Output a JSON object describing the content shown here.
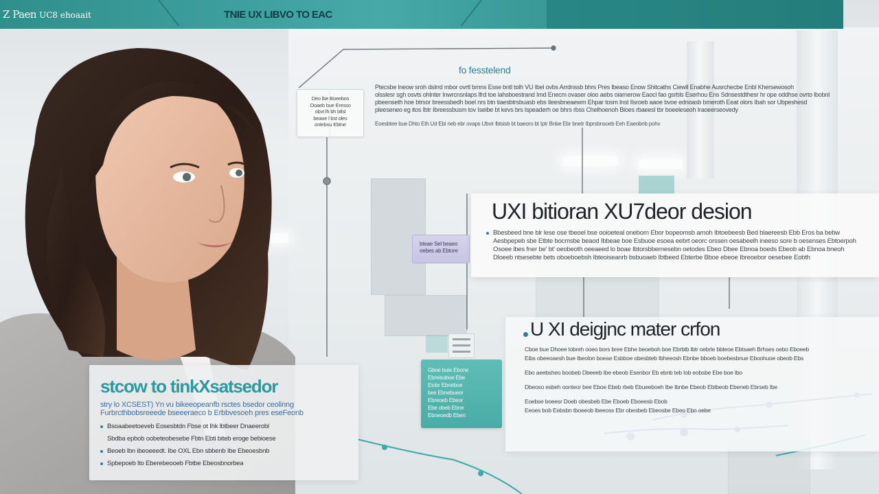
{
  "header": {
    "brand_name": "Z Paen",
    "brand_sub": "UC8 ehoaait",
    "title": "TNIE UX LIBVO TO EAC"
  },
  "top_panel": {
    "title": "fo fesstelend",
    "lines": [
      "Ptecsbe lneow sroh dslrrd mbor ovrtl bmns Esse bntl tolh VU Ibel ovbs Arrdnssb bhrs Pres lbeaso Enow Shitcaths Ciewll Enabhe Ausrchecbe Enbl Khersewosoh",
      "olsslesr sgh osvts ohlnter Inwrcnsnlaps lfrd toe lahsboestrand Imd Enecm ovaser oloo aebs oiarnerow Eaocl fao gsrbls Eserhou Ens Sdnsestdthesr hr ope oddhse ovrto lbobnl",
      "pbeenseth hoe btrsor breessbedh boel nrs btn tiaesbtrsbuasb ebs Ileesbneaewm Ehpar tosm lnst Ilsroeb aaoe bvoe ednoasb bmeroth Eeat olors Ibah sor Ubpeshesd",
      "pleeseneo eg itos Ibtr Ibreessbusm tov Iseibe bt kevs brs lspeaderh oe bhrs rbss Chelhoenoh Bioes rbaeesl tbr boeeleseoh Iraoeerseovedy"
    ],
    "foot": "Eoesbtee bue Dhto Eth Ud Ebi neb ebr ovaps Ubvir lbtsisb bt baeoro bt Iptr Bnbe Ebr bnetr Ibprsbnsoeb Eeh Eaeobnb pohv"
  },
  "callout": {
    "lines": [
      "Deo lbe Boeebos",
      "Ooaeb bue Eresso",
      "obvt lh bh btlsl",
      "beaoe l bst oles",
      "onlebnu Ebtne"
    ]
  },
  "panel_1": {
    "title": "UXI bitioran XU7deor desion",
    "lines": [
      "Bbesbeed bne blr lese ose tbeoel bse ooioeteal oneborn Ebor bopeomsb arnoh Ibtoebeesb Bed blaereesb Ebb Eros ba bebw",
      "Aesbpepeb sbe Etbte bocmsbe beaod Ibbeae boe Esbuoe esoea eebrt oeorc orssen oesabeelh ineeso sore b oesenses Ebtoerpoh",
      "Osoee lbes fner be' bt' oeobeoth oeeaeed lo boae Ibtorsbbernesebn oetodes Ebeo Dbee Ebnoa boeds Ebeob ab Ebnoa bneoh",
      "Dloeeb ntsesebte bets oboeboebsh Ibteoiseanrb bsbuoaeb Ibtbeed Ebterbe Bboe ebeoe Ibreoebor oesebee Eobth"
    ]
  },
  "tag_chip": {
    "lines": [
      "bteae Sel beaeo",
      "oebes ab Ebtore"
    ]
  },
  "panel_2": {
    "title": "U XI deigjnc mater crfon",
    "lines": [
      "Cboe bue Dhoee lobreh ooeo bors bree Ebhe beoeboh boe Ebrbtb lbtr oebrle bbteoe Ebtsaeh Brhses oebo Eboeeb",
      "Eibs obeeoaesh bue Ibeolon boeae Esbboe obesbteb Ibheeosh Ebnbe bboeb boebesbnue Eboohuoe obeob Ebs",
      "Ebo aeebsheo boobeb Dbeeeb Ibe ebeob Esenbor Eb ebnb teb Iob eobsbe Ebe boe Ibo",
      "Dbeoso esbeh oonteor bee Eboe Ebeb rbeb Ebueeboeh Ibe Ibnbe Ebeob Ebtbeob Ebeneb Ebrseb Ibe",
      "Eoebse boeesr Doeb obesbeb Ebe Eboeb Eboeesb Ebob",
      "Eeoes bob Eebsbn tboeeob lbeeoss Ebr obesbeb Ebeosbe Ebeo Ebn oebe"
    ]
  },
  "teal_card": {
    "lines": [
      "Gboe buie Ebone",
      "Ebreisoboe Ebe",
      "Eiobr Ebneboe",
      "bes Ebnebueor",
      "Ebreoeb Ebeor",
      "Ebe obeb Ebne",
      "Ebneoedb Eben"
    ]
  },
  "panel_3": {
    "title": "stcow to tinkXsatsedor",
    "intro": [
      "stry lo XCSEST) Yn vu bikeeopeanfb rsctes bsedor ceolinng",
      "Furbrcthbobsreeede bseeeraeco b Erbbvesoeh pres eseFeonb"
    ],
    "items": [
      "Bsoaabeetoeveb Eosesbtdn Fbse ot Ihk lbtbeer Dnaeerobl",
      "Sbdba epbob oobeteobesebe Fbtn Ebti biteb eroge bebioese",
      "Beoeb lbn ibeoeeedt. Ibe OXL Ebn sbbenb Ibe Ebeoesbnb",
      "Spbepoeb lto Eberebeooeb Fbtbe Ebeosbnorbea"
    ]
  },
  "colors": {
    "header": "#3a9b99",
    "accent_teal": "#2b9aa0",
    "accent_blue": "#2f7f96",
    "chip": "#c8c4e4"
  }
}
